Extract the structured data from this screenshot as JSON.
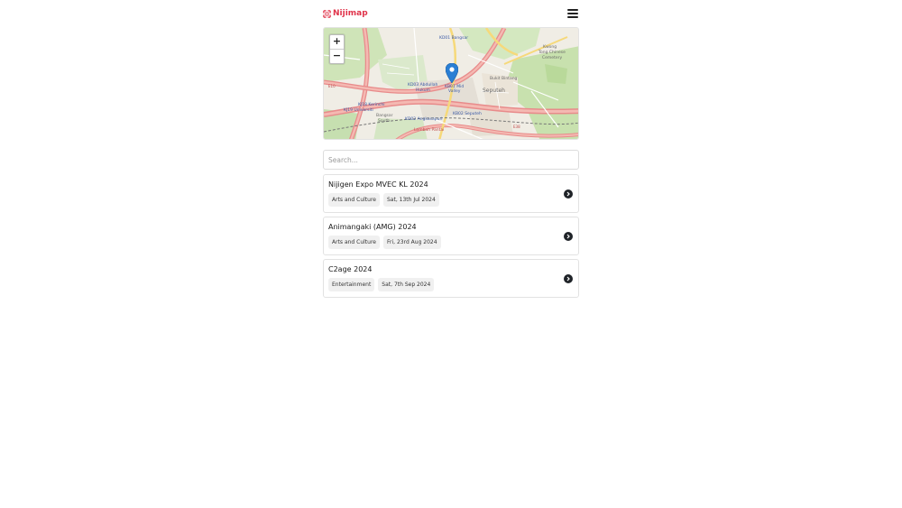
{
  "header": {
    "brand": "Nijimap",
    "logo_icon": "map-frame-icon",
    "menu_icon": "hamburger-menu-icon"
  },
  "map": {
    "zoom_in": "+",
    "zoom_out": "−",
    "labels": [
      "KD01 Bangsar",
      "Kwong Tong Chinese Cemetery",
      "KD03 Abdullah Hukum",
      "KB01 Mid Valley",
      "Bukit Bintang",
      "Seputeh",
      "KD02 Angkasapuri",
      "KB02 Seputeh",
      "KJ18 Kerinchi",
      "KJ19 Universiti",
      "Bangsar South",
      "Lembah Pantai",
      "Taman Pudu"
    ],
    "marker_icon": "location-pin-icon"
  },
  "search": {
    "placeholder": "Search...",
    "value": ""
  },
  "events": [
    {
      "title": "Nijigen Expo MVEC KL 2024",
      "category": "Arts and Culture",
      "date": "Sat, 13th Jul 2024"
    },
    {
      "title": "Animangaki (AMG) 2024",
      "category": "Arts and Culture",
      "date": "Fri, 23rd Aug 2024"
    },
    {
      "title": "C2age 2024",
      "category": "Entertainment",
      "date": "Sat, 7th Sep 2024"
    }
  ],
  "colors": {
    "brand": "#e0334a",
    "marker": "#2a7fd4",
    "chevron_bg": "#1f2328"
  }
}
